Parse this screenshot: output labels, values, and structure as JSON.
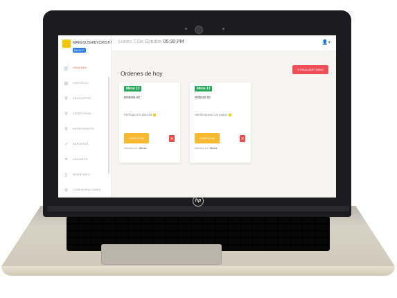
{
  "brand": {
    "name": "MAKESUSHIBYCRISTIN",
    "badge": "BASICO"
  },
  "topbar": {
    "date_prefix": "Lunes 7 De Octubre",
    "time": "05:30 PM",
    "user_icon": "user-icon"
  },
  "sidebar": {
    "items": [
      {
        "label": "ORDENES",
        "icon": "cart-icon",
        "active": true
      },
      {
        "label": "HISTORICO",
        "icon": "printer-icon",
        "active": false
      },
      {
        "label": "PRODUCTOS",
        "icon": "utensils-icon",
        "active": false
      },
      {
        "label": "CATEGORIAS",
        "icon": "utensils-icon",
        "active": false
      },
      {
        "label": "INGREDIENTES",
        "icon": "utensils-icon",
        "active": false
      },
      {
        "label": "REPORTES",
        "icon": "chart-icon",
        "active": false
      },
      {
        "label": "USUARIOS",
        "icon": "user-icon",
        "active": false
      },
      {
        "label": "INVENTARIO",
        "icon": "box-icon",
        "active": false
      },
      {
        "label": "CONFIGURACIONES",
        "icon": "gear-icon",
        "active": false
      }
    ]
  },
  "main": {
    "title": "Ordenes de hoy",
    "end_shift_label": "✕  FINALIZAR TURNO"
  },
  "orders": [
    {
      "table": "Mesa 13",
      "total": "RD$295.00",
      "item": "Pechuga a la plancha",
      "qty": "1",
      "done_label": "COMPLETAR",
      "attended_label": "Atendido por:",
      "attended_by": "Nieves"
    },
    {
      "table": "Mesa 13",
      "total": "RD$250.00",
      "item": "Hamburguesa con papas",
      "qty": "1",
      "done_label": "COMPLETAR",
      "attended_label": "Atendido por:",
      "attended_by": "Nieves"
    }
  ],
  "colors": {
    "accent": "#e8623a",
    "danger": "#ef4f59",
    "success": "#25a85a",
    "warning": "#f7b92f"
  }
}
